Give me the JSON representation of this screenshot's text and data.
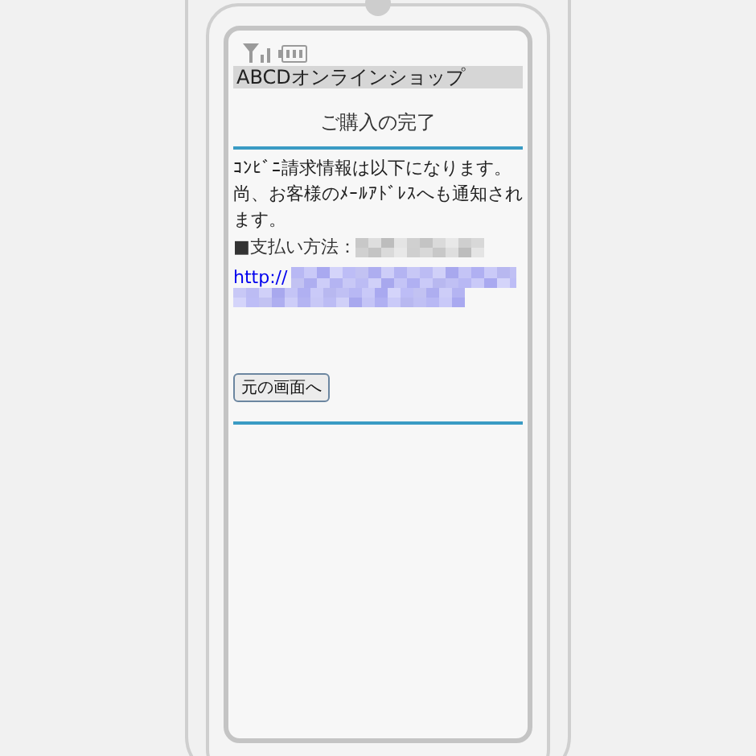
{
  "site_header": {
    "title": "ABCDオンラインショップ"
  },
  "page_title": "ご購入の完了",
  "message": "ｺﾝﾋﾞﾆ請求情報は以下になります。尚、お客様のﾒｰﾙｱﾄﾞﾚｽへも通知されます。",
  "payment_label": "■支払い方法：",
  "link_prefix": "http://",
  "back_button": "元の画面へ"
}
